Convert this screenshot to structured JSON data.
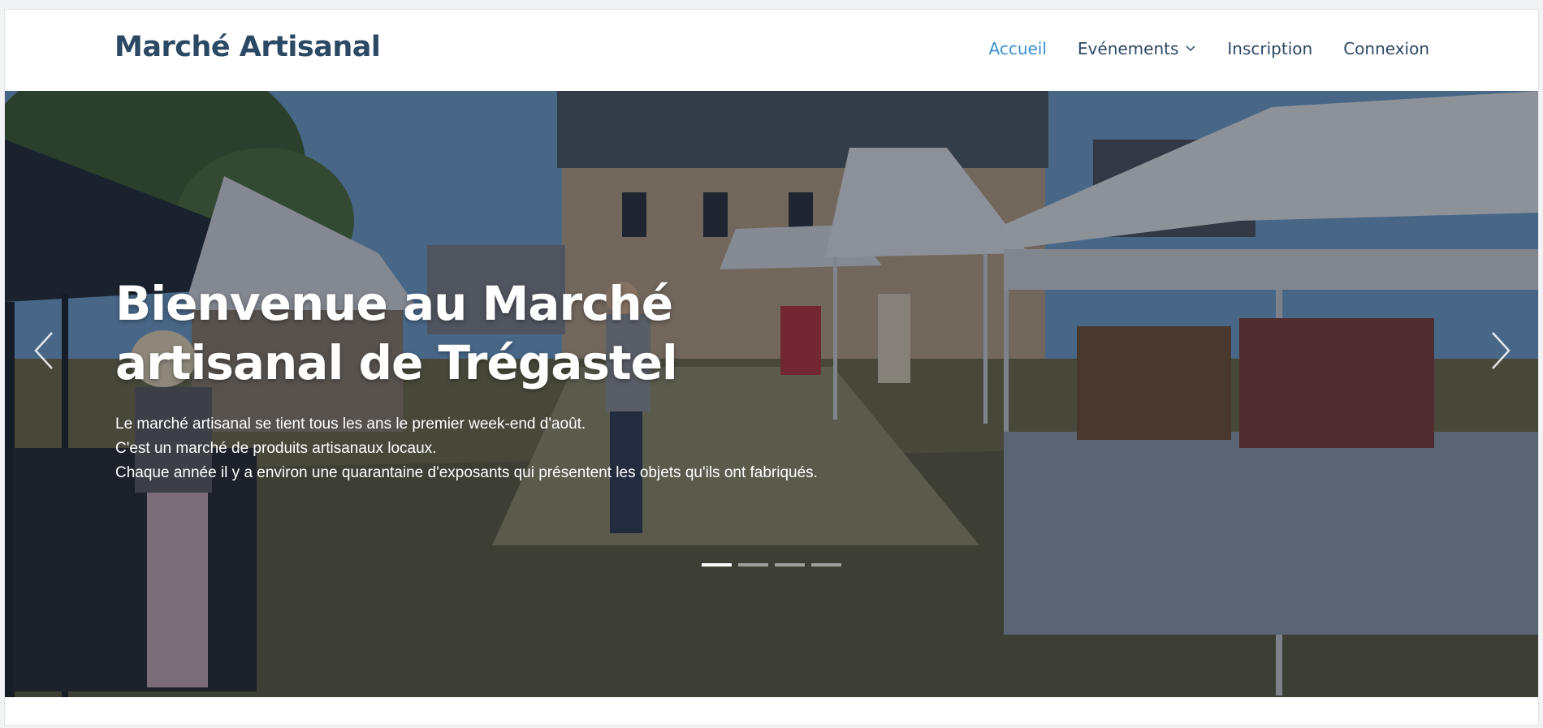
{
  "header": {
    "brand": "Marché Artisanal",
    "nav": [
      {
        "label": "Accueil",
        "active": true
      },
      {
        "label": "Evénements",
        "dropdown": true
      },
      {
        "label": "Inscription"
      },
      {
        "label": "Connexion"
      }
    ]
  },
  "hero": {
    "title": "Bienvenue au Marché artisanal de Trégastel",
    "description": [
      "Le marché artisanal se tient tous les ans le premier week-end d'août.",
      "C'est un marché de produits artisanaux locaux.",
      "Chaque année il y a environ une quarantaine d'exposants qui présentent les objets qu'ils ont fabriqués."
    ],
    "slides_count": 4,
    "active_slide": 1
  },
  "icons": {
    "prev": "chevron-left-icon",
    "next": "chevron-right-icon",
    "dropdown": "chevron-down-icon"
  },
  "colors": {
    "brand": "#2c4964",
    "nav_active": "#3b8fd0",
    "nav_text": "#2c4964",
    "overlay": "#121a28"
  }
}
